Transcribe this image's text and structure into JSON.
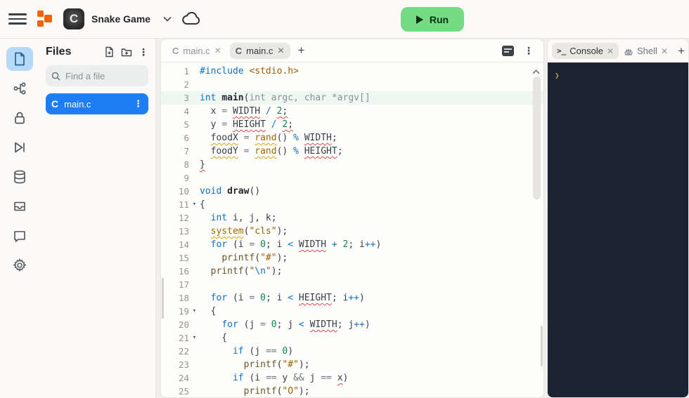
{
  "header": {
    "title": "Snake Game",
    "app_language_badge": "C",
    "run_label": "Run"
  },
  "sidebar": {
    "icons": [
      "files",
      "source-control",
      "lock",
      "skip-run",
      "database",
      "inbox",
      "chat",
      "settings"
    ],
    "active": "files"
  },
  "files": {
    "title": "Files",
    "search_placeholder": "Find a file",
    "items": [
      {
        "name": "main.c",
        "icon": "C",
        "selected": true
      }
    ],
    "selected_color": "#1e7df2"
  },
  "editor": {
    "tabs": [
      {
        "label": "main.c",
        "icon": "C",
        "active": false
      },
      {
        "label": "main.c",
        "icon": "C",
        "active": true
      }
    ],
    "code": {
      "lines": [
        {
          "n": 1,
          "seg": [
            {
              "t": "#include",
              "c": "kw"
            },
            {
              "t": " ",
              "c": "pl"
            },
            {
              "t": "<stdio.h>",
              "c": "str"
            }
          ]
        },
        {
          "n": 2,
          "seg": []
        },
        {
          "n": 3,
          "hl": true,
          "seg": [
            {
              "t": "int",
              "c": "kw"
            },
            {
              "t": " ",
              "c": "pl"
            },
            {
              "t": "main",
              "c": "fn"
            },
            {
              "t": "(",
              "c": "pl"
            },
            {
              "t": "int argc, char *argv[]",
              "c": "gray"
            }
          ]
        },
        {
          "n": 4,
          "seg": [
            {
              "t": "  x ",
              "c": "pl"
            },
            {
              "t": "=",
              "c": "op2"
            },
            {
              "t": " ",
              "c": "pl"
            },
            {
              "t": "WIDTH",
              "c": "pl err"
            },
            {
              "t": " ",
              "c": "pl"
            },
            {
              "t": "/",
              "c": "op"
            },
            {
              "t": " ",
              "c": "pl"
            },
            {
              "t": "2",
              "c": "num err"
            },
            {
              "t": ";",
              "c": "pl err"
            }
          ]
        },
        {
          "n": 5,
          "seg": [
            {
              "t": "  y ",
              "c": "pl"
            },
            {
              "t": "=",
              "c": "op2"
            },
            {
              "t": " ",
              "c": "pl"
            },
            {
              "t": "HEIGHT",
              "c": "pl err"
            },
            {
              "t": " ",
              "c": "pl"
            },
            {
              "t": "/",
              "c": "op"
            },
            {
              "t": " ",
              "c": "pl"
            },
            {
              "t": "2",
              "c": "num err"
            },
            {
              "t": ";",
              "c": "pl err"
            }
          ]
        },
        {
          "n": 6,
          "seg": [
            {
              "t": "  ",
              "c": "pl"
            },
            {
              "t": "foodX",
              "c": "pl warn"
            },
            {
              "t": " ",
              "c": "pl"
            },
            {
              "t": "=",
              "c": "op2"
            },
            {
              "t": " ",
              "c": "pl"
            },
            {
              "t": "rand",
              "c": "call2 warn"
            },
            {
              "t": "() ",
              "c": "pl"
            },
            {
              "t": "%",
              "c": "op"
            },
            {
              "t": " ",
              "c": "pl"
            },
            {
              "t": "WIDTH",
              "c": "pl err"
            },
            {
              "t": ";",
              "c": "pl"
            }
          ]
        },
        {
          "n": 7,
          "seg": [
            {
              "t": "  ",
              "c": "pl"
            },
            {
              "t": "foodY",
              "c": "pl warn"
            },
            {
              "t": " ",
              "c": "pl"
            },
            {
              "t": "=",
              "c": "op2"
            },
            {
              "t": " ",
              "c": "pl"
            },
            {
              "t": "rand",
              "c": "call2 warn"
            },
            {
              "t": "() ",
              "c": "pl"
            },
            {
              "t": "%",
              "c": "op"
            },
            {
              "t": " ",
              "c": "pl"
            },
            {
              "t": "HEIGHT",
              "c": "pl err"
            },
            {
              "t": ";",
              "c": "pl"
            }
          ]
        },
        {
          "n": 8,
          "seg": [
            {
              "t": "}",
              "c": "pl err"
            }
          ]
        },
        {
          "n": 9,
          "seg": []
        },
        {
          "n": 10,
          "seg": [
            {
              "t": "void",
              "c": "kw"
            },
            {
              "t": " ",
              "c": "pl"
            },
            {
              "t": "draw",
              "c": "fn"
            },
            {
              "t": "()",
              "c": "pl"
            }
          ]
        },
        {
          "n": 11,
          "fold": true,
          "seg": [
            {
              "t": "{",
              "c": "pl"
            }
          ]
        },
        {
          "n": 12,
          "seg": [
            {
              "t": "  ",
              "c": "pl"
            },
            {
              "t": "int",
              "c": "kw"
            },
            {
              "t": " i, j, k;",
              "c": "pl"
            }
          ]
        },
        {
          "n": 13,
          "seg": [
            {
              "t": "  ",
              "c": "pl"
            },
            {
              "t": "system",
              "c": "call2 warn"
            },
            {
              "t": "(",
              "c": "pl"
            },
            {
              "t": "\"cls\"",
              "c": "str"
            },
            {
              "t": ");",
              "c": "pl"
            }
          ]
        },
        {
          "n": 14,
          "seg": [
            {
              "t": "  ",
              "c": "pl"
            },
            {
              "t": "for",
              "c": "kw"
            },
            {
              "t": " (i ",
              "c": "pl"
            },
            {
              "t": "=",
              "c": "op2"
            },
            {
              "t": " ",
              "c": "pl"
            },
            {
              "t": "0",
              "c": "num"
            },
            {
              "t": "; i ",
              "c": "pl"
            },
            {
              "t": "<",
              "c": "op"
            },
            {
              "t": " ",
              "c": "pl"
            },
            {
              "t": "WIDTH",
              "c": "pl err"
            },
            {
              "t": " ",
              "c": "pl"
            },
            {
              "t": "+",
              "c": "op"
            },
            {
              "t": " ",
              "c": "pl"
            },
            {
              "t": "2",
              "c": "num"
            },
            {
              "t": "; i",
              "c": "pl"
            },
            {
              "t": "++",
              "c": "op"
            },
            {
              "t": ")",
              "c": "pl"
            }
          ]
        },
        {
          "n": 15,
          "seg": [
            {
              "t": "    ",
              "c": "pl"
            },
            {
              "t": "printf",
              "c": "call"
            },
            {
              "t": "(",
              "c": "pl"
            },
            {
              "t": "\"#\"",
              "c": "str"
            },
            {
              "t": ");",
              "c": "pl"
            }
          ]
        },
        {
          "n": 16,
          "seg": [
            {
              "t": "  ",
              "c": "pl"
            },
            {
              "t": "printf",
              "c": "call"
            },
            {
              "t": "(",
              "c": "pl"
            },
            {
              "t": "\"",
              "c": "str"
            },
            {
              "t": "\\n",
              "c": "kw"
            },
            {
              "t": "\"",
              "c": "str"
            },
            {
              "t": ");",
              "c": "pl"
            }
          ]
        },
        {
          "n": 17,
          "seg": []
        },
        {
          "n": 18,
          "seg": [
            {
              "t": "  ",
              "c": "pl"
            },
            {
              "t": "for",
              "c": "kw"
            },
            {
              "t": " (i ",
              "c": "pl"
            },
            {
              "t": "=",
              "c": "op2"
            },
            {
              "t": " ",
              "c": "pl"
            },
            {
              "t": "0",
              "c": "num"
            },
            {
              "t": "; i ",
              "c": "pl"
            },
            {
              "t": "<",
              "c": "op"
            },
            {
              "t": " ",
              "c": "pl"
            },
            {
              "t": "HEIGHT",
              "c": "pl err"
            },
            {
              "t": "; i",
              "c": "pl"
            },
            {
              "t": "++",
              "c": "op"
            },
            {
              "t": ")",
              "c": "pl"
            }
          ]
        },
        {
          "n": 19,
          "fold": true,
          "seg": [
            {
              "t": "  {",
              "c": "pl"
            }
          ]
        },
        {
          "n": 20,
          "seg": [
            {
              "t": "    ",
              "c": "pl"
            },
            {
              "t": "for",
              "c": "kw"
            },
            {
              "t": " (j ",
              "c": "pl"
            },
            {
              "t": "=",
              "c": "op2"
            },
            {
              "t": " ",
              "c": "pl"
            },
            {
              "t": "0",
              "c": "num"
            },
            {
              "t": "; j ",
              "c": "pl"
            },
            {
              "t": "<",
              "c": "op"
            },
            {
              "t": " ",
              "c": "pl"
            },
            {
              "t": "WIDTH",
              "c": "pl err"
            },
            {
              "t": "; j",
              "c": "pl"
            },
            {
              "t": "++",
              "c": "op"
            },
            {
              "t": ")",
              "c": "pl"
            }
          ]
        },
        {
          "n": 21,
          "fold": true,
          "seg": [
            {
              "t": "    {",
              "c": "pl"
            }
          ]
        },
        {
          "n": 22,
          "seg": [
            {
              "t": "      ",
              "c": "pl"
            },
            {
              "t": "if",
              "c": "kw"
            },
            {
              "t": " (j ",
              "c": "pl"
            },
            {
              "t": "==",
              "c": "op2"
            },
            {
              "t": " ",
              "c": "pl"
            },
            {
              "t": "0",
              "c": "num"
            },
            {
              "t": ")",
              "c": "pl"
            }
          ]
        },
        {
          "n": 23,
          "seg": [
            {
              "t": "        ",
              "c": "pl"
            },
            {
              "t": "printf",
              "c": "call"
            },
            {
              "t": "(",
              "c": "pl"
            },
            {
              "t": "\"#\"",
              "c": "str"
            },
            {
              "t": ");",
              "c": "pl"
            }
          ]
        },
        {
          "n": 24,
          "seg": [
            {
              "t": "      ",
              "c": "pl"
            },
            {
              "t": "if",
              "c": "kw"
            },
            {
              "t": " (i ",
              "c": "pl"
            },
            {
              "t": "==",
              "c": "op2"
            },
            {
              "t": " y ",
              "c": "pl"
            },
            {
              "t": "&&",
              "c": "op2"
            },
            {
              "t": " j ",
              "c": "pl"
            },
            {
              "t": "==",
              "c": "op2"
            },
            {
              "t": " ",
              "c": "pl"
            },
            {
              "t": "x",
              "c": "pl err"
            },
            {
              "t": ")",
              "c": "pl"
            }
          ]
        },
        {
          "n": 25,
          "seg": [
            {
              "t": "        ",
              "c": "pl"
            },
            {
              "t": "printf",
              "c": "call"
            },
            {
              "t": "(",
              "c": "pl"
            },
            {
              "t": "\"O\"",
              "c": "str"
            },
            {
              "t": ");",
              "c": "pl"
            }
          ]
        }
      ]
    }
  },
  "console": {
    "tabs": [
      {
        "label": "Console",
        "active": true
      },
      {
        "label": "Shell",
        "active": false
      }
    ],
    "prompt_symbol": "❯",
    "background": "#1c2333"
  }
}
